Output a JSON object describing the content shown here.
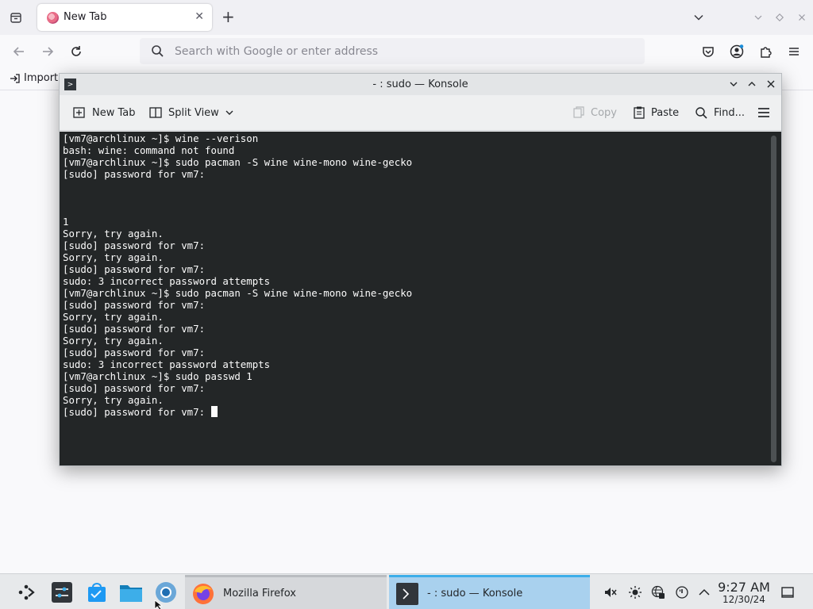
{
  "browser": {
    "tab_title": "New Tab",
    "url_placeholder": "Search with Google or enter address",
    "bookmark_import": "Import"
  },
  "konsole": {
    "window_title": "- : sudo — Konsole",
    "toolbar": {
      "new_tab": "New Tab",
      "split_view": "Split View",
      "copy": "Copy",
      "paste": "Paste",
      "find": "Find..."
    },
    "terminal_lines": [
      "[vm7@archlinux ~]$ wine --verison",
      "bash: wine: command not found",
      "[vm7@archlinux ~]$ sudo pacman -S wine wine-mono wine-gecko",
      "[sudo] password for vm7:",
      "",
      "",
      "",
      "1",
      "Sorry, try again.",
      "[sudo] password for vm7:",
      "Sorry, try again.",
      "[sudo] password for vm7:",
      "sudo: 3 incorrect password attempts",
      "[vm7@archlinux ~]$ sudo pacman -S wine wine-mono wine-gecko",
      "[sudo] password for vm7:",
      "Sorry, try again.",
      "[sudo] password for vm7:",
      "Sorry, try again.",
      "[sudo] password for vm7:",
      "sudo: 3 incorrect password attempts",
      "[vm7@archlinux ~]$ sudo passwd 1",
      "[sudo] password for vm7:",
      "Sorry, try again.",
      "[sudo] password for vm7: "
    ]
  },
  "taskbar": {
    "tasks": [
      {
        "label": "Mozilla Firefox"
      },
      {
        "label": "- : sudo — Konsole"
      }
    ],
    "clock": {
      "time": "9:27 AM",
      "date": "12/30/24"
    }
  },
  "colors": {
    "terminal_bg": "#232627",
    "terminal_fg": "#fcfcfc",
    "active_task": "#a9d1ee",
    "accent": "#3daee9"
  }
}
